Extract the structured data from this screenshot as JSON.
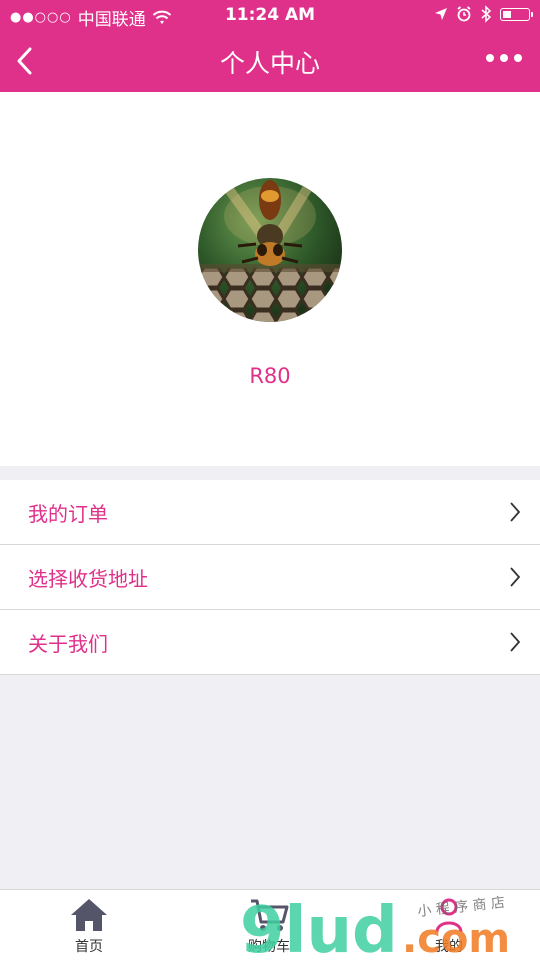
{
  "status_bar": {
    "signal": "●●○○○",
    "carrier": "中国联通",
    "time": "11:24 AM"
  },
  "nav": {
    "title": "个人中心",
    "back_icon": "chevron-left-icon",
    "more_icon": "more-dots-icon"
  },
  "profile": {
    "username": "R80",
    "avatar_icon": "avatar-photo"
  },
  "menu": {
    "items": [
      {
        "label": "我的订单"
      },
      {
        "label": "选择收货地址"
      },
      {
        "label": "关于我们"
      }
    ]
  },
  "tabs": [
    {
      "label": "首页",
      "icon": "home-icon"
    },
    {
      "label": "购物车",
      "icon": "cart-icon"
    },
    {
      "label": "我的",
      "icon": "user-icon"
    }
  ],
  "watermark": {
    "brand": "9lud",
    "suffix": ".com",
    "tagline": "小 程 序 商 店"
  },
  "colors": {
    "accent": "#e0318a",
    "background": "#efeff4",
    "tab_icon": "#55556a"
  }
}
